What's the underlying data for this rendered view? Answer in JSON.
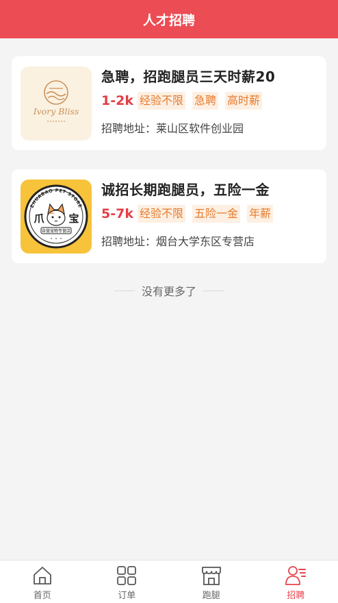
{
  "header": {
    "title": "人才招聘",
    "color": "#ec4c54"
  },
  "jobs": [
    {
      "logo": {
        "text": "Ivory Bliss",
        "icon": "ivory-bliss-logo"
      },
      "title": "急聘，招跑腿员三天时薪20",
      "salary": "1-2k",
      "tags": [
        "经验不限",
        "急聘",
        "高时薪"
      ],
      "address_label": "招聘地址：",
      "address": "莱山区软件创业园"
    },
    {
      "logo": {
        "text_top": "ZHUABAO PET STORE",
        "char_left": "爪",
        "char_right": "宝",
        "ribbon": "自营宠物专营店",
        "icon": "zhuabao-pet-store-logo"
      },
      "title": "诚招长期跑腿员，五险一金",
      "salary": "5-7k",
      "tags": [
        "经验不限",
        "五险一金",
        "年薪"
      ],
      "address_label": "招聘地址：",
      "address": "烟台大学东区专营店"
    }
  ],
  "footer_text": "没有更多了",
  "tabbar": {
    "items": [
      {
        "label": "首页",
        "icon": "home-icon",
        "active": false
      },
      {
        "label": "订单",
        "icon": "grid-icon",
        "active": false
      },
      {
        "label": "跑腿",
        "icon": "shop-icon",
        "active": false
      },
      {
        "label": "招聘",
        "icon": "user-list-icon",
        "active": true
      }
    ],
    "active_color": "#e9434c"
  }
}
